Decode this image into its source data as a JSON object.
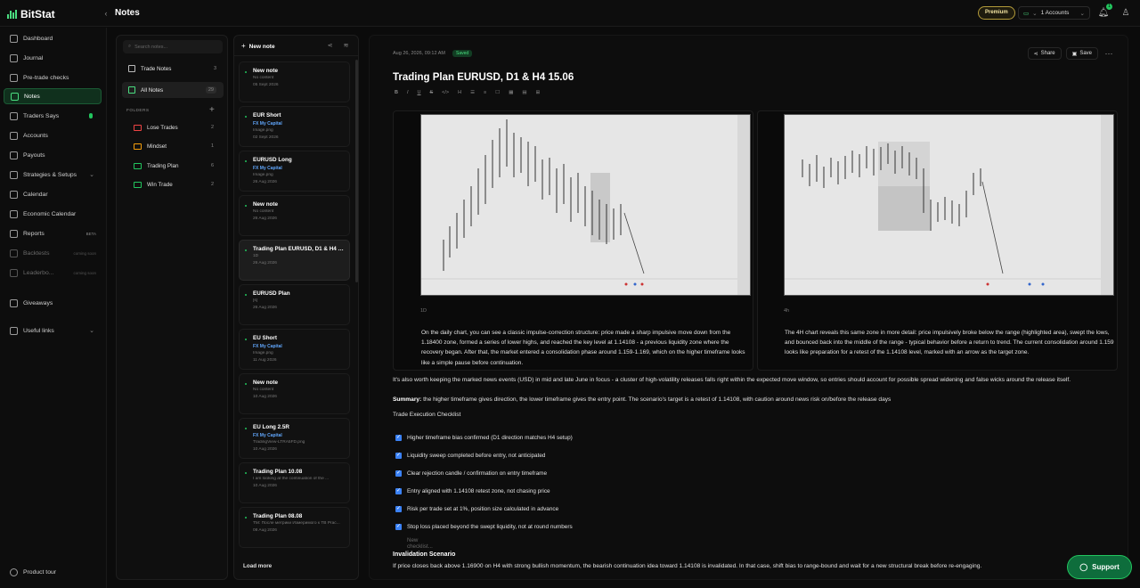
{
  "app": {
    "name": "BitStat",
    "page_title": "Notes"
  },
  "topbar": {
    "premium_label": "Premium",
    "accounts_label": "1 Accounts",
    "notification_count": "1"
  },
  "sidebar": {
    "items": [
      {
        "label": "Dashboard",
        "icon": "dashboard-icon"
      },
      {
        "label": "Journal",
        "icon": "book-icon"
      },
      {
        "label": "Pre-trade checks",
        "icon": "checklist-icon"
      },
      {
        "label": "Notes",
        "icon": "note-icon"
      },
      {
        "label": "Traders Says",
        "icon": "chat-icon"
      },
      {
        "label": "Accounts",
        "icon": "wallet-icon"
      },
      {
        "label": "Payouts",
        "icon": "dollar-icon"
      },
      {
        "label": "Strategies & Setups",
        "icon": "strategy-icon"
      },
      {
        "label": "Calendar",
        "icon": "calendar-icon"
      },
      {
        "label": "Economic Calendar",
        "icon": "calendar-icon"
      },
      {
        "label": "Reports",
        "icon": "chart-icon",
        "tag": "BETA"
      },
      {
        "label": "Backtests",
        "icon": "clock-icon",
        "tag": "coming soon"
      },
      {
        "label": "Leaderbo...",
        "icon": "trophy-icon",
        "tag": "coming soon"
      },
      {
        "label": "Giveaways",
        "icon": "gift-icon"
      },
      {
        "label": "Useful links",
        "icon": "link-icon"
      }
    ],
    "product_tour": "Product tour"
  },
  "folders_panel": {
    "search_placeholder": "Search notes...",
    "trade_notes": {
      "label": "Trade Notes",
      "count": "3"
    },
    "all_notes": {
      "label": "All Notes",
      "count": "29"
    },
    "folders_heading": "FOLDERS",
    "folders": [
      {
        "label": "Lose Trades",
        "count": "2",
        "color": "#ef4444"
      },
      {
        "label": "Mindset",
        "count": "1",
        "color": "#f59e0b"
      },
      {
        "label": "Trading Plan",
        "count": "6",
        "color": "#22c55e"
      },
      {
        "label": "Win Trade",
        "count": "2",
        "color": "#22c55e"
      }
    ]
  },
  "notes_list": {
    "new_note_label": "New note",
    "load_more": "Load more",
    "notes": [
      {
        "title": "New note",
        "account": "",
        "preview": "No content",
        "date": "05 Sept 2026"
      },
      {
        "title": "EUR Short",
        "account": "FX My Capital",
        "preview": "Image.png",
        "date": "02 Sept 2026"
      },
      {
        "title": "EURUSD Long",
        "account": "FX My Capital",
        "preview": "Image.png",
        "date": "26 Aug 2026"
      },
      {
        "title": "New note",
        "account": "",
        "preview": "No content",
        "date": "26 Aug 2026"
      },
      {
        "title": "Trading Plan EURUSD, D1 & H4 15.06",
        "account": "",
        "preview": "1D",
        "date": "26 Aug 2026"
      },
      {
        "title": "EURUSD Plan",
        "account": "",
        "preview": "[s]",
        "date": "26 Aug 2026"
      },
      {
        "title": "EU Short",
        "account": "FX My Capital",
        "preview": "Image.png",
        "date": "11 Aug 2026"
      },
      {
        "title": "New note",
        "account": "",
        "preview": "No content",
        "date": "10 Aug 2026"
      },
      {
        "title": "EU Long 2.5R",
        "account": "FX My Capital",
        "preview": "TradingView-LTRA5FD.png",
        "date": "10 Aug 2026"
      },
      {
        "title": "Trading Plan 10.08",
        "account": "",
        "preview": "I am looking at the continuation of the ...",
        "date": "10 Aug 2026"
      },
      {
        "title": "Trading Plan 08.08",
        "account": "",
        "preview": "TM: После метрики Измеримого к TB Prac...",
        "date": "08 Aug 2026"
      }
    ]
  },
  "editor": {
    "date": "Aug 26, 2026, 09:12 AM",
    "status": "Saved",
    "share_label": "Share",
    "save_label": "Save",
    "title": "Trading Plan EURUSD, D1 & H4 15.06",
    "toolbar": [
      "B",
      "I",
      "U",
      "S",
      "</>",
      "H",
      "☰",
      "≡",
      "☐",
      "▦",
      "▤",
      "⊞"
    ],
    "images": [
      {
        "caption": "1D",
        "text": "On the daily chart, you can see a classic impulse-correction structure: price made a sharp impulsive move down from the 1.18400 zone, formed a series of lower highs, and reached the key level at 1.14108 - a previous liquidity zone where the recovery began. After that, the market entered a consolidation phase around 1.159-1.169, which on the higher timeframe looks like a simple pause before continuation."
      },
      {
        "caption": "4h",
        "text": "The 4H chart reveals this same zone in more detail: price impulsively broke below the range (highlighted area), swept the lows, and bounced back into the middle of the range - typical behavior before a return to trend. The current consolidation around 1.159 looks like preparation for a retest of the 1.14108 level, marked with an arrow as the target zone."
      }
    ],
    "paragraph_news": "It's also worth keeping the marked news events (USD) in mid and late June in focus - a cluster of high-volatility releases falls right within the expected move window, so entries should account for possible spread widening and false wicks around the release itself.",
    "summary_label": "Summary:",
    "summary_text": "the higher timeframe gives direction, the lower timeframe gives the entry point. The scenario's target is a retest of 1.14108, with caution around news risk on/before the release days",
    "checklist_title": "Trade Execution Checklist",
    "checklist": [
      "Higher timeframe bias confirmed (D1 direction matches H4 setup)",
      "Liquidity sweep completed before entry, not anticipated",
      "Clear rejection candle / confirmation on entry timeframe",
      "Entry aligned with 1.14108 retest zone, not chasing price",
      "Risk per trade set at 1%, position size calculated in advance",
      "Stop loss placed beyond the swept liquidity, not at round numbers"
    ],
    "new_checklist_placeholder": "New checklist...",
    "invalidation_heading": "Invalidation Scenario",
    "invalidation_text": "If price closes back above 1.16900 on H4 with strong bullish momentum, the bearish continuation idea toward 1.14108 is invalidated. In that case, shift bias to range-bound and wait for a new structural break before re-engaging."
  },
  "support_label": "Support"
}
